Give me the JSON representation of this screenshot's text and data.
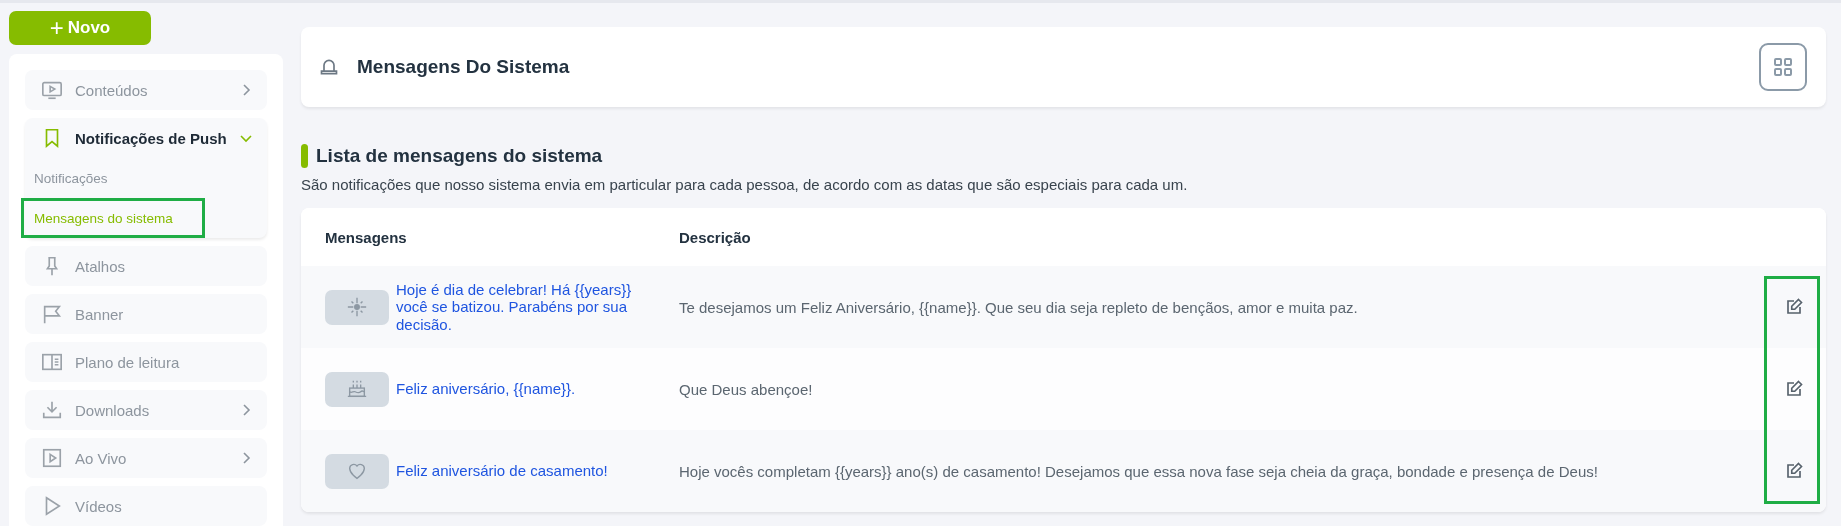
{
  "new_button": {
    "label": "Novo",
    "icon": "+"
  },
  "sidebar": {
    "items": [
      {
        "label": "Conteúdos",
        "selected": false,
        "expanded": false,
        "has_children": true
      },
      {
        "label": "Notificações de Push",
        "selected": true,
        "expanded": true,
        "has_children": true,
        "children": [
          {
            "label": "Notificações",
            "selected": false,
            "highlighted": false
          },
          {
            "label": "Mensagens do sistema",
            "selected": true,
            "highlighted": true
          }
        ]
      },
      {
        "label": "Atalhos",
        "selected": false,
        "expanded": false,
        "has_children": false
      },
      {
        "label": "Banner",
        "selected": false,
        "expanded": false,
        "has_children": false
      },
      {
        "label": "Plano de leitura",
        "selected": false,
        "expanded": false,
        "has_children": false
      },
      {
        "label": "Downloads",
        "selected": false,
        "expanded": false,
        "has_children": true
      },
      {
        "label": "Ao Vivo",
        "selected": false,
        "expanded": false,
        "has_children": true
      },
      {
        "label": "Vídeos",
        "selected": false,
        "expanded": false,
        "has_children": false
      }
    ]
  },
  "header": {
    "title": "Mensagens Do Sistema"
  },
  "section": {
    "title": "Lista de mensagens do sistema",
    "description": "São notificações que nosso sistema envia em particular para cada pessoa, de acordo com as datas que são especiais para cada um."
  },
  "table": {
    "columns": [
      "Mensagens",
      "Descrição"
    ],
    "actions_highlighted": true,
    "rows": [
      {
        "message": "Hoje é dia de celebrar! Há {{years}} você se batizou. Parabéns por sua decisão.",
        "description": "Te desejamos um Feliz Aniversário, {{name}}. Que seu dia seja repleto de bençãos, amor e muita paz."
      },
      {
        "message": "Feliz aniversário, {{name}}.",
        "description": "Que Deus abençoe!"
      },
      {
        "message": "Feliz aniversário de casamento!",
        "description": "Hoje vocês completam {{years}} ano(s) de casamento! Desejamos que essa nova fase seja cheia da graça, bondade e presença de Deus!"
      }
    ]
  }
}
